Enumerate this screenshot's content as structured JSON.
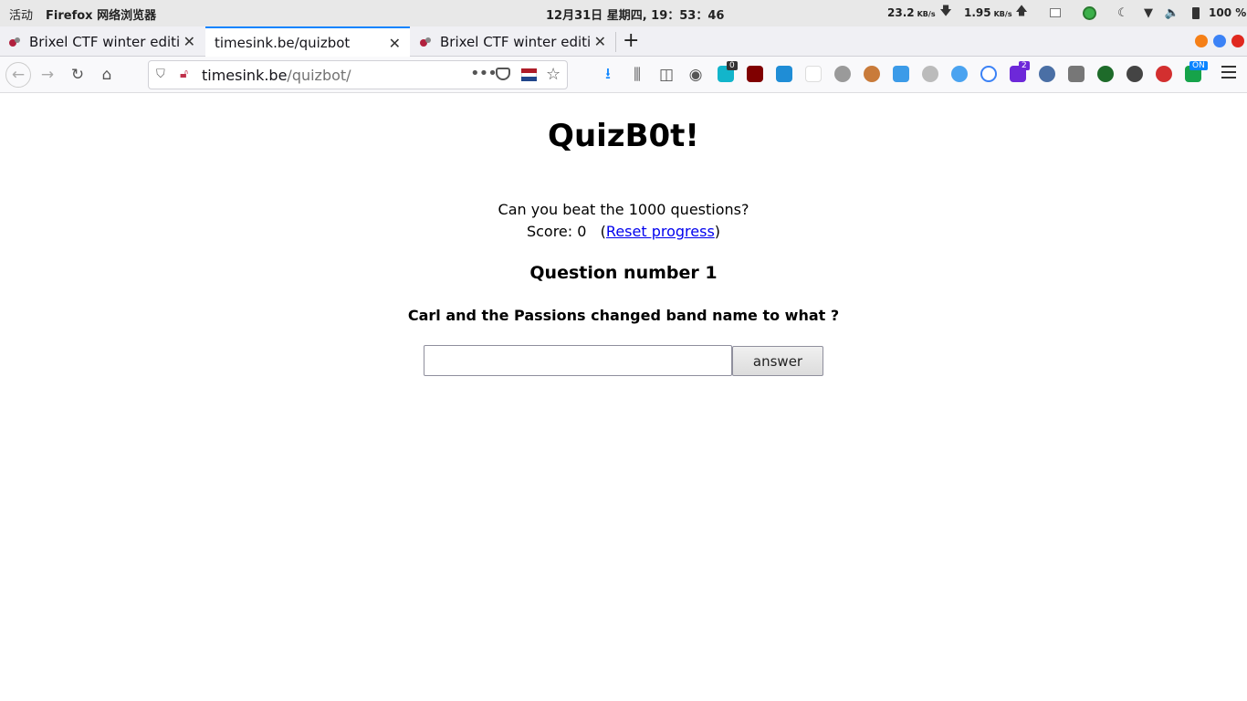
{
  "system_bar": {
    "activities": "活动",
    "app_name": "Firefox 网络浏览器",
    "clock": "12月31日 星期四, 19：53：46",
    "download_speed": "23.2",
    "upload_speed": "1.95",
    "speed_unit": "KB/s",
    "battery": "100 %"
  },
  "tabs": [
    {
      "title": "Brixel CTF winter edition",
      "active": false
    },
    {
      "title": "timesink.be/quizbot",
      "active": true
    },
    {
      "title": "Brixel CTF winter edition",
      "active": false
    }
  ],
  "urlbar": {
    "domain": "timesink.be",
    "path": "/quizbot/"
  },
  "extension_badges": {
    "counter_a": "0",
    "counter_b": "2",
    "on_badge": "ON"
  },
  "page": {
    "title": "QuizB0t!",
    "intro": "Can you beat the 1000 questions?",
    "score_label": "Score: 0",
    "reset_link": "Reset progress",
    "question_heading": "Question number 1",
    "question_text": "Carl and the Passions changed band name to what ?",
    "answer_value": "",
    "answer_button": "answer"
  },
  "colors": {
    "tab_accent": "#0a84ff",
    "link": "#0000ee"
  }
}
